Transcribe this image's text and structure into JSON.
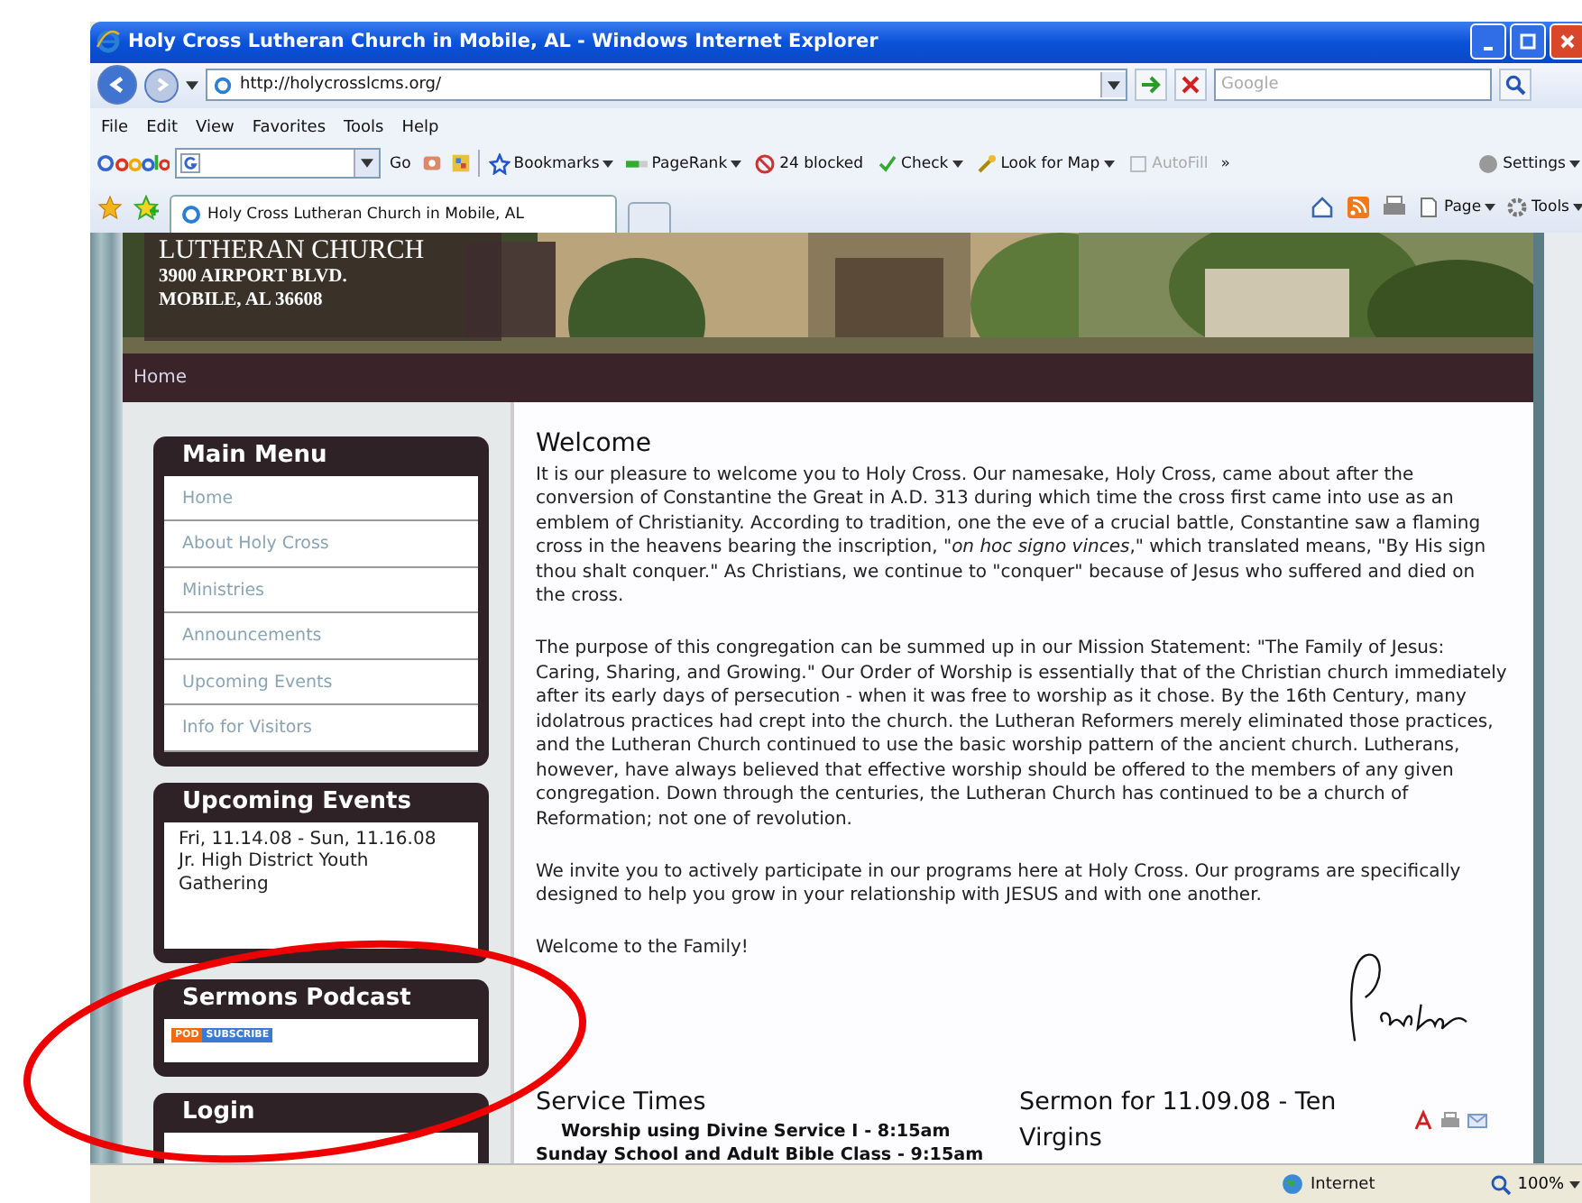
{
  "window": {
    "title": "Holy Cross Lutheran Church in Mobile, AL - Windows Internet Explorer"
  },
  "address_bar": {
    "url": "http://holycrosslcms.org/",
    "search_placeholder": "Google"
  },
  "menu": [
    "File",
    "Edit",
    "View",
    "Favorites",
    "Tools",
    "Help"
  ],
  "google_toolbar": {
    "go": "Go",
    "items": [
      {
        "label": "Bookmarks",
        "has_menu": true,
        "disabled": false
      },
      {
        "label": "PageRank",
        "has_menu": true,
        "disabled": false
      },
      {
        "label": "24 blocked",
        "has_menu": false,
        "disabled": false
      },
      {
        "label": "Check",
        "has_menu": true,
        "disabled": false
      },
      {
        "label": "Look for Map",
        "has_menu": true,
        "disabled": false
      },
      {
        "label": "AutoFill",
        "has_menu": false,
        "disabled": true
      }
    ],
    "more": "»",
    "settings": "Settings"
  },
  "tabs": [
    {
      "label": "Holy Cross Lutheran Church in Mobile, AL",
      "selected": true
    }
  ],
  "command_bar": [
    "Page",
    "Tools"
  ],
  "site": {
    "header_lines": [
      "LUTHERAN CHURCH",
      "3900 AIRPORT BLVD.",
      "MOBILE, AL 36608"
    ],
    "nav": [
      "Home"
    ],
    "main_menu": {
      "title": "Main Menu",
      "items": [
        "Home",
        "About Holy Cross",
        "Ministries",
        "Announcements",
        "Upcoming Events",
        "Info for Visitors"
      ]
    },
    "upcoming_events": {
      "title": "Upcoming Events",
      "lines": [
        "Fri, 11.14.08 - Sun, 11.16.08",
        "Jr. High District Youth Gathering"
      ]
    },
    "podcast": {
      "title": "Sermons Podcast",
      "badge_left": "POD",
      "badge_right": "SUBSCRIBE"
    },
    "login": {
      "title": "Login"
    },
    "welcome": {
      "heading": "Welcome",
      "paragraphs": [
        "It is our pleasure to welcome you to Holy Cross.  Our namesake, Holy Cross, came about after the conversion of Constantine the Great in A.D. 313 during which time the cross first came into use as an emblem of Christianity.  According to tradition, one the eve of a crucial battle, Constantine saw a flaming cross in the heavens bearing the inscription, \"*on hoc signo vinces*,\" which translated means, \"By His sign thou shalt conquer.\"  As Christians, we continue to \"conquer\" because of Jesus who suffered and died on the cross.",
        "The purpose of this congregation can be summed up in our Mission Statement: \"The Family of Jesus: Caring, Sharing, and Growing.\"  Our Order of Worship is essentially that of the Christian church immediately after its early days of persecution - when it was free to worship as it chose.  By the 16th Century, many idolatrous practices had crept into the church.  the Lutheran Reformers merely eliminated those practices, and the Lutheran Church continued to use the basic worship pattern of the ancient church.  Lutherans, however, have always believed that effective worship should be offered to the members of any given congregation.  Down through the centuries, the Lutheran Church has continued to be a church of Reformation; not one of revolution.",
        "We invite you to actively participate in our programs here at Holy Cross.  Our programs are specifically designed to help you grow in your relationship with JESUS and with one another.",
        "Welcome to the Family!"
      ]
    },
    "service_times": {
      "heading": "Service Times",
      "lines": [
        "Worship using Divine Service I - 8:15am",
        "Sunday School and Adult Bible Class - 9:15am"
      ]
    },
    "sermon": {
      "heading": "Sermon for 11.09.08 - Ten Virgins"
    }
  },
  "status_bar": {
    "zone": "Internet",
    "zoom": "100%"
  }
}
